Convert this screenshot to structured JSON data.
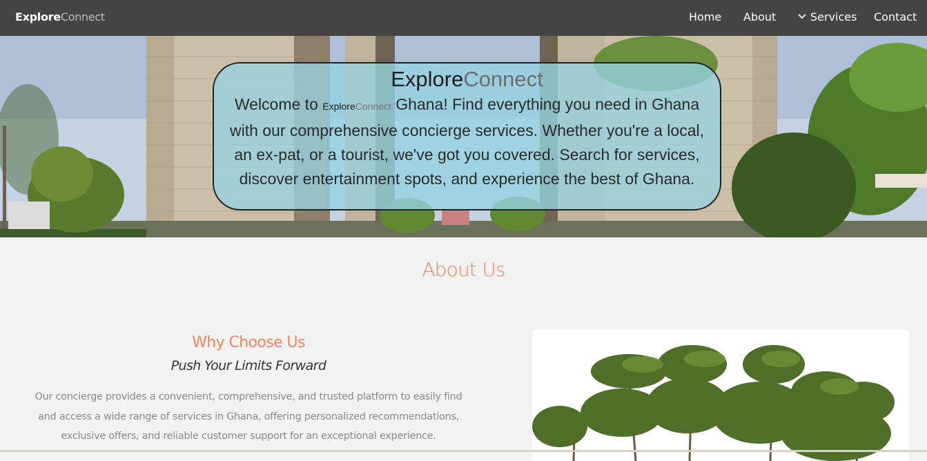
{
  "navbar": {
    "brand_part1": "Explore",
    "brand_part2": "Connect",
    "links": [
      {
        "label": "Home"
      },
      {
        "label": "About"
      },
      {
        "label": "Services",
        "icon": "chevron-down-icon"
      },
      {
        "label": "Contact"
      }
    ]
  },
  "hero": {
    "title_part1": "Explore",
    "title_part2": "Connect",
    "text_before": "Welcome to ",
    "inline_brand1": "Explore",
    "inline_brand2": "Connect",
    "text_after": " Ghana! Find everything you need in Ghana with our comprehensive concierge services. Whether you're a local, an ex-pat, or a tourist, we've got you covered. Search for services, discover entertainment spots, and experience the best of Ghana."
  },
  "about": {
    "heading": "About Us",
    "why_heading": "Why Choose Us",
    "why_subheading": "Push Your Limits Forward",
    "why_paragraph": "Our concierge provides a convenient, comprehensive, and trusted platform to easily find and access a wide range of services in Ghana, offering personalized recommendations, exclusive offers, and reliable customer support for an exceptional experience."
  },
  "colors": {
    "navbar_bg": "#444444",
    "accent": "#f4845f",
    "hero_card_bg": "#96d4e2",
    "page_bg": "#f2f2f2"
  }
}
